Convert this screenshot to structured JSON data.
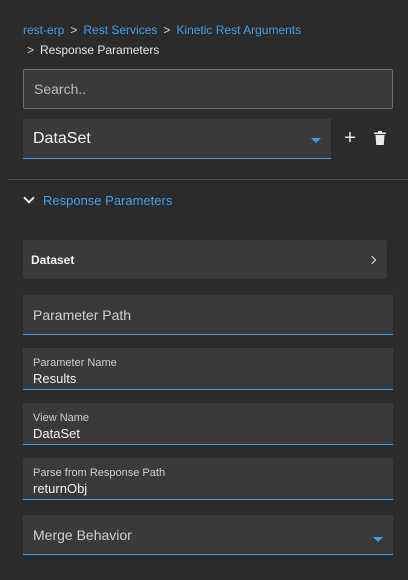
{
  "breadcrumb": {
    "items": [
      "rest-erp",
      "Rest Services",
      "Kinetic Rest Arguments"
    ],
    "separator": ">",
    "current": "Response Parameters"
  },
  "search": {
    "placeholder": "Search.."
  },
  "dataset_select": {
    "value": "DataSet"
  },
  "toolbar": {
    "add_icon": "+",
    "delete_icon": "trash-icon"
  },
  "section": {
    "title": "Response Parameters"
  },
  "dataset_row": {
    "label": "Dataset"
  },
  "fields": {
    "parameter_path": {
      "label": "Parameter Path"
    },
    "parameter_name": {
      "label": "Parameter Name",
      "value": "Results"
    },
    "view_name": {
      "label": "View Name",
      "value": "DataSet"
    },
    "parse_path": {
      "label": "Parse from Response Path",
      "value": "returnObj"
    },
    "merge_behavior": {
      "label": "Merge Behavior"
    }
  },
  "colors": {
    "background": "#2b2b2b",
    "field": "#3a3a3a",
    "accent": "#3ea0ea",
    "text": "#e8e8e8"
  }
}
